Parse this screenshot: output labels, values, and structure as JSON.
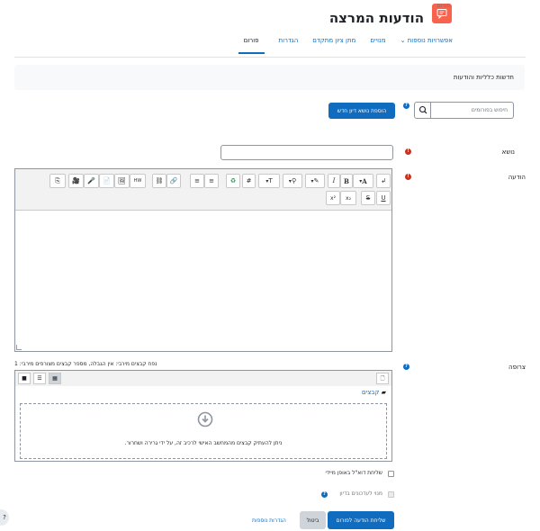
{
  "header": {
    "breadcrumb": "פורום",
    "title": "הודעות המרצה"
  },
  "tabs": [
    {
      "label": "פורום",
      "active": true
    },
    {
      "label": "הגדרות",
      "active": false
    },
    {
      "label": "מתן ציון מתקדם",
      "active": false
    },
    {
      "label": "מנויים",
      "active": false
    },
    {
      "label": "אפשרויות נוספות",
      "active": false
    }
  ],
  "info_bar": "חדשות כלליות והודעות",
  "search": {
    "placeholder": "חיפוש בפורומים"
  },
  "add_discussion_button": "הוספת נושא דיון חדש",
  "form": {
    "subject_label": "נושא",
    "message_label": "הודעה",
    "attachment_label": "צרופה",
    "attachment_limits": "נפח קבצים מירבי: אין הגבלה, מספר קבצים מצורפים מירבי: 1",
    "files_folder": "קבצים",
    "dropzone_text": "ניתן להעתיק קבצים מהמחשב האישי לרכיב זה, על ידי גרירה ושחרור.",
    "mail_now_label": "שליחת דוא\"ל באופן מיידי",
    "subscribe_label": "מנוי לעדכונים בדיון",
    "submit_button": "שליחת הודעה לפורום",
    "cancel_button": "ביטול",
    "advanced_button": "הגדרות נוספות"
  },
  "toolbar_row1": [
    "↲",
    "A",
    "B",
    "I",
    "✎",
    "⚲",
    "T",
    "#",
    "♻",
    "≡",
    "≡",
    "🔗",
    "⛓",
    "HW",
    "🖼",
    "📄",
    "🎤",
    "🎥",
    "⎘"
  ],
  "toolbar_row2": [
    "U",
    "S",
    "x₂",
    "x²"
  ],
  "colors": {
    "primary": "#0f6cbf",
    "header_icon": "#f7634d",
    "required": "#ca3120"
  }
}
